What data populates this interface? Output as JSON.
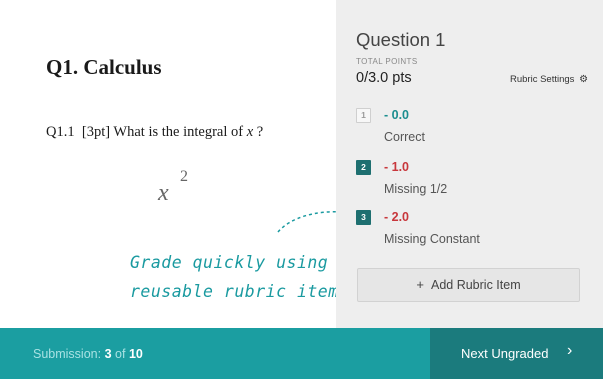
{
  "document": {
    "title": "Q1. Calculus",
    "question_label": "Q1.1",
    "question_points": "[3pt]",
    "question_text": "What is the integral of",
    "question_var": "x",
    "question_end": "?",
    "answer_base": "x",
    "answer_exp": "2",
    "hint_line1": "Grade quickly using",
    "hint_line2": "reusable rubric items"
  },
  "panel": {
    "title": "Question 1",
    "total_points_label": "TOTAL POINTS",
    "total_points_value": "0/3.0 pts",
    "settings_label": "Rubric Settings",
    "settings_icon": "gear-icon",
    "rubric_items": [
      {
        "number": "1",
        "points": "- 0.0",
        "description": "Correct",
        "selected": false
      },
      {
        "number": "2",
        "points": "- 1.0",
        "description": "Missing 1/2",
        "selected": true
      },
      {
        "number": "3",
        "points": "- 2.0",
        "description": "Missing Constant",
        "selected": true
      }
    ],
    "add_label": "Add Rubric Item"
  },
  "footer": {
    "submission_label": "Submission:",
    "current": "3",
    "of": "of",
    "total": "10",
    "next_label": "Next Ungraded"
  },
  "colors": {
    "accent": "#1b9ea1",
    "accent_dark": "#1b7b7d",
    "negative": "#c8373c",
    "zero": "#1a8d8f"
  }
}
